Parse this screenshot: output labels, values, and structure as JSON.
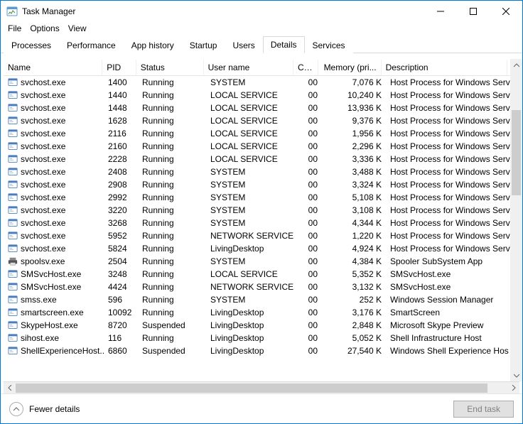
{
  "window": {
    "title": "Task Manager"
  },
  "menu": [
    "File",
    "Options",
    "View"
  ],
  "tabs": [
    "Processes",
    "Performance",
    "App history",
    "Startup",
    "Users",
    "Details",
    "Services"
  ],
  "active_tab": 5,
  "columns": [
    "Name",
    "PID",
    "Status",
    "User name",
    "CPU",
    "Memory (pri...",
    "Description"
  ],
  "footer": {
    "fewer": "Fewer details",
    "end_task": "End task"
  },
  "rows": [
    {
      "icon": "app",
      "name": "svchost.exe",
      "pid": "1400",
      "status": "Running",
      "user": "SYSTEM",
      "cpu": "00",
      "mem": "7,076 K",
      "desc": "Host Process for Windows Serv"
    },
    {
      "icon": "app",
      "name": "svchost.exe",
      "pid": "1440",
      "status": "Running",
      "user": "LOCAL SERVICE",
      "cpu": "00",
      "mem": "10,240 K",
      "desc": "Host Process for Windows Serv"
    },
    {
      "icon": "app",
      "name": "svchost.exe",
      "pid": "1448",
      "status": "Running",
      "user": "LOCAL SERVICE",
      "cpu": "00",
      "mem": "13,936 K",
      "desc": "Host Process for Windows Serv"
    },
    {
      "icon": "app",
      "name": "svchost.exe",
      "pid": "1628",
      "status": "Running",
      "user": "LOCAL SERVICE",
      "cpu": "00",
      "mem": "9,376 K",
      "desc": "Host Process for Windows Serv"
    },
    {
      "icon": "app",
      "name": "svchost.exe",
      "pid": "2116",
      "status": "Running",
      "user": "LOCAL SERVICE",
      "cpu": "00",
      "mem": "1,956 K",
      "desc": "Host Process for Windows Serv"
    },
    {
      "icon": "app",
      "name": "svchost.exe",
      "pid": "2160",
      "status": "Running",
      "user": "LOCAL SERVICE",
      "cpu": "00",
      "mem": "2,296 K",
      "desc": "Host Process for Windows Serv"
    },
    {
      "icon": "app",
      "name": "svchost.exe",
      "pid": "2228",
      "status": "Running",
      "user": "LOCAL SERVICE",
      "cpu": "00",
      "mem": "3,336 K",
      "desc": "Host Process for Windows Serv"
    },
    {
      "icon": "app",
      "name": "svchost.exe",
      "pid": "2408",
      "status": "Running",
      "user": "SYSTEM",
      "cpu": "00",
      "mem": "3,488 K",
      "desc": "Host Process for Windows Serv"
    },
    {
      "icon": "app",
      "name": "svchost.exe",
      "pid": "2908",
      "status": "Running",
      "user": "SYSTEM",
      "cpu": "00",
      "mem": "3,324 K",
      "desc": "Host Process for Windows Serv"
    },
    {
      "icon": "app",
      "name": "svchost.exe",
      "pid": "2992",
      "status": "Running",
      "user": "SYSTEM",
      "cpu": "00",
      "mem": "5,108 K",
      "desc": "Host Process for Windows Serv"
    },
    {
      "icon": "app",
      "name": "svchost.exe",
      "pid": "3220",
      "status": "Running",
      "user": "SYSTEM",
      "cpu": "00",
      "mem": "3,108 K",
      "desc": "Host Process for Windows Serv"
    },
    {
      "icon": "app",
      "name": "svchost.exe",
      "pid": "3268",
      "status": "Running",
      "user": "SYSTEM",
      "cpu": "00",
      "mem": "4,344 K",
      "desc": "Host Process for Windows Serv"
    },
    {
      "icon": "app",
      "name": "svchost.exe",
      "pid": "5952",
      "status": "Running",
      "user": "NETWORK SERVICE",
      "cpu": "00",
      "mem": "1,220 K",
      "desc": "Host Process for Windows Serv"
    },
    {
      "icon": "app",
      "name": "svchost.exe",
      "pid": "5824",
      "status": "Running",
      "user": "LivingDesktop",
      "cpu": "00",
      "mem": "4,924 K",
      "desc": "Host Process for Windows Serv"
    },
    {
      "icon": "printer",
      "name": "spoolsv.exe",
      "pid": "2504",
      "status": "Running",
      "user": "SYSTEM",
      "cpu": "00",
      "mem": "4,384 K",
      "desc": "Spooler SubSystem App"
    },
    {
      "icon": "app",
      "name": "SMSvcHost.exe",
      "pid": "3248",
      "status": "Running",
      "user": "LOCAL SERVICE",
      "cpu": "00",
      "mem": "5,352 K",
      "desc": "SMSvcHost.exe"
    },
    {
      "icon": "app",
      "name": "SMSvcHost.exe",
      "pid": "4424",
      "status": "Running",
      "user": "NETWORK SERVICE",
      "cpu": "00",
      "mem": "3,132 K",
      "desc": "SMSvcHost.exe"
    },
    {
      "icon": "app",
      "name": "smss.exe",
      "pid": "596",
      "status": "Running",
      "user": "SYSTEM",
      "cpu": "00",
      "mem": "252 K",
      "desc": "Windows Session Manager"
    },
    {
      "icon": "app",
      "name": "smartscreen.exe",
      "pid": "10092",
      "status": "Running",
      "user": "LivingDesktop",
      "cpu": "00",
      "mem": "3,176 K",
      "desc": "SmartScreen"
    },
    {
      "icon": "app",
      "name": "SkypeHost.exe",
      "pid": "8720",
      "status": "Suspended",
      "user": "LivingDesktop",
      "cpu": "00",
      "mem": "2,848 K",
      "desc": "Microsoft Skype Preview"
    },
    {
      "icon": "app",
      "name": "sihost.exe",
      "pid": "116",
      "status": "Running",
      "user": "LivingDesktop",
      "cpu": "00",
      "mem": "5,052 K",
      "desc": "Shell Infrastructure Host"
    },
    {
      "icon": "app",
      "name": "ShellExperienceHost....",
      "pid": "6860",
      "status": "Suspended",
      "user": "LivingDesktop",
      "cpu": "00",
      "mem": "27,540 K",
      "desc": "Windows Shell Experience Hos"
    }
  ]
}
